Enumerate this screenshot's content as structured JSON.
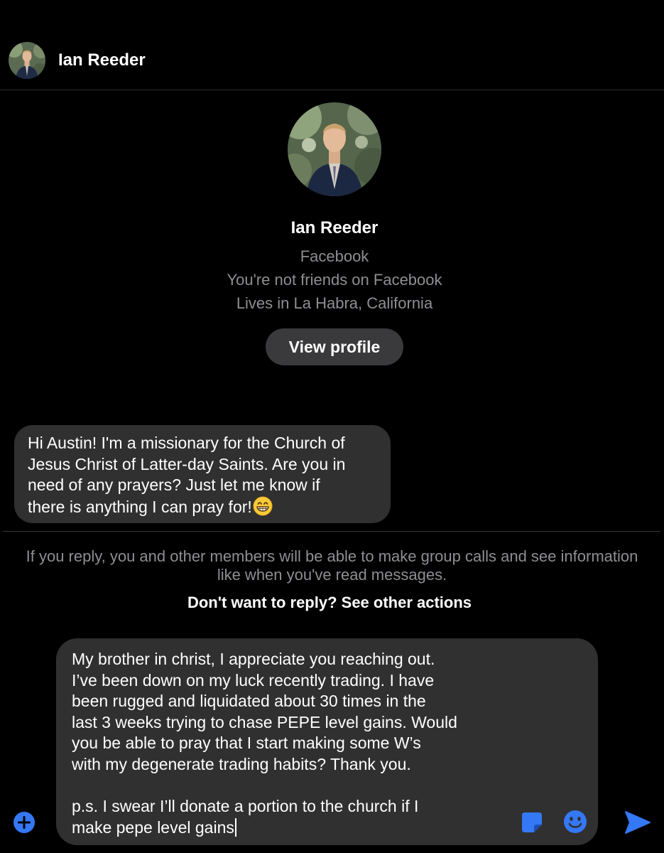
{
  "header": {
    "contact_name": "Ian Reeder",
    "avatar_icon": "person-photo-avatar"
  },
  "profile": {
    "name": "Ian Reeder",
    "source": "Facebook",
    "relationship": "You're not friends on Facebook",
    "location": "Lives in La Habra, California",
    "view_profile_label": "View profile"
  },
  "conversation": {
    "incoming_message": {
      "lines": [
        "Hi Austin! I'm a missionary for the Church of",
        "Jesus Christ of Latter-day Saints. Are you in",
        "need of any prayers? Just let me know if",
        "there is anything I can pray for!"
      ],
      "emoji": "grinning-face-with-smiling-eyes"
    }
  },
  "request_notice": {
    "line1": "If you reply, you and other members will be able to make group calls and see information",
    "line2": "like when you've read messages.",
    "other_actions_label": "Don't want to reply? See other actions"
  },
  "composer": {
    "draft_paragraph1_lines": [
      "My brother in christ, I appreciate you reaching out.",
      "I’ve been down on my luck recently trading. I have",
      "been rugged and liquidated about 30 times in the",
      "last 3 weeks trying to chase PEPE level gains. Would",
      "you be able to pray that I start making some W’s",
      "with my degenerate trading habits? Thank you."
    ],
    "draft_paragraph2_lines": [
      "p.s. I swear I’ll donate a portion to the church if I",
      "make pepe level gains"
    ],
    "icons": {
      "add": "plus-circle-icon",
      "sticker": "sticker-icon",
      "emoji": "smiley-icon",
      "send": "send-icon"
    }
  },
  "colors": {
    "background": "#000000",
    "bubble": "#303030",
    "button": "#3a3a3c",
    "muted_text": "#8e8e93",
    "accent_blue": "#3478f6"
  }
}
